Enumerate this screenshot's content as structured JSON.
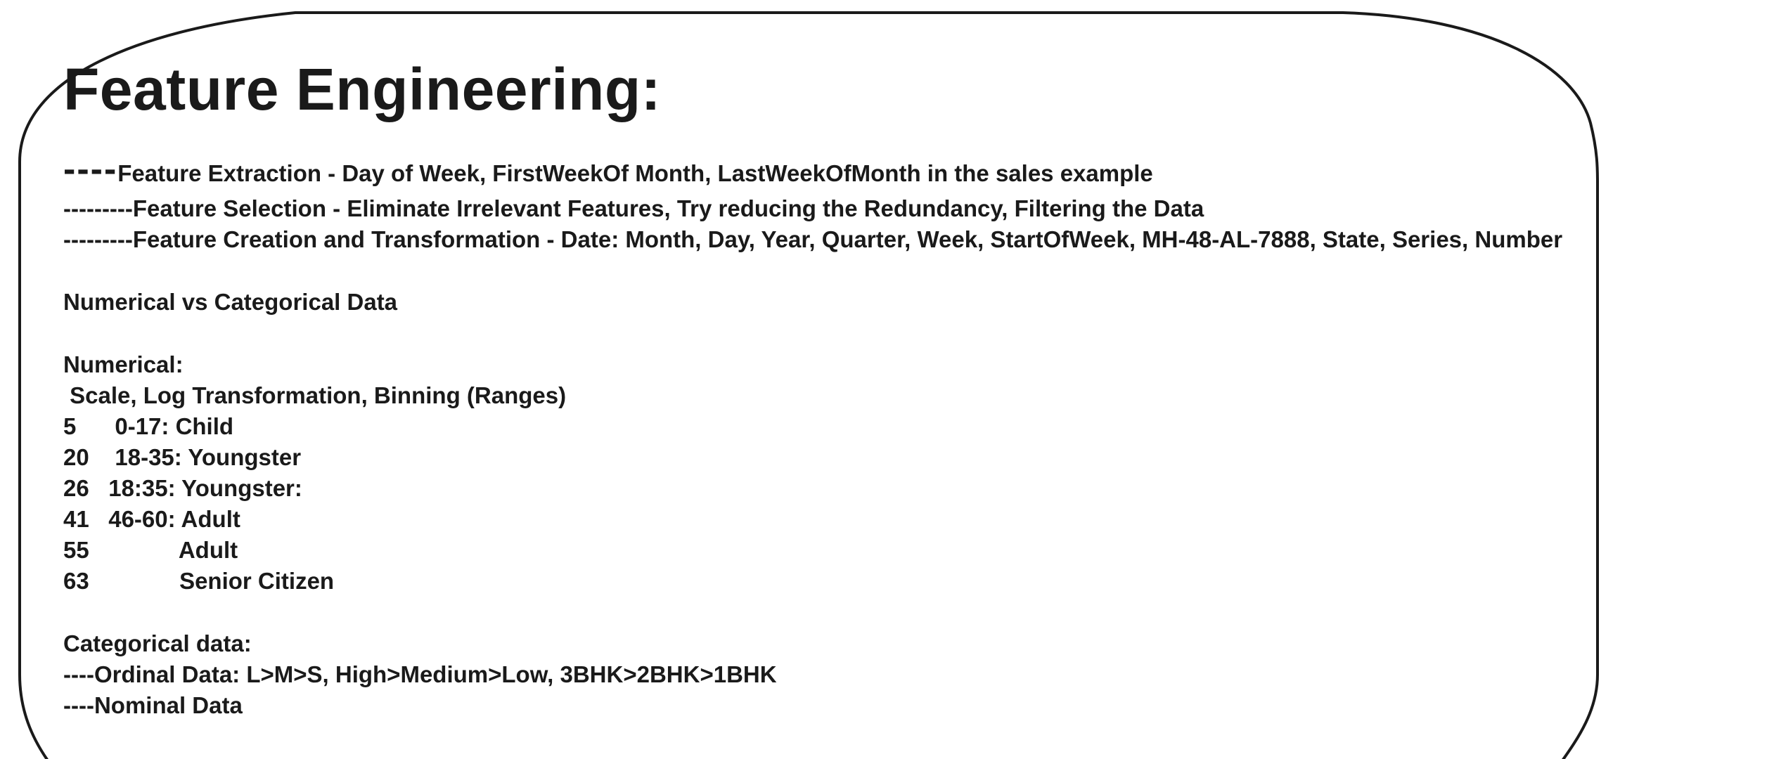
{
  "document": {
    "title": "Feature Engineering:",
    "feature_lines": [
      {
        "lead": "----",
        "text": "Feature Extraction - Day of Week, FirstWeekOf Month, LastWeekOfMonth in the sales example"
      },
      {
        "lead": "",
        "text": "---------Feature Selection - Eliminate Irrelevant Features, Try reducing the Redundancy, Filtering the Data"
      },
      {
        "lead": "",
        "text": "---------Feature Creation and Transformation - Date: Month, Day, Year, Quarter, Week, StartOfWeek, MH-48-AL-7888, State, Series, Number"
      }
    ],
    "comparison_heading": "Numerical vs Categorical Data",
    "numerical": {
      "heading": "Numerical:",
      "methods": " Scale, Log Transformation, Binning (Ranges)",
      "rows": [
        "5      0-17: Child",
        "20    18-35: Youngster",
        "26   18:35: Youngster:",
        "41   46-60: Adult",
        "55              Adult",
        "63              Senior Citizen"
      ]
    },
    "categorical": {
      "heading": "Categorical data:",
      "ordinal": "----Ordinal Data: L>M>S, High>Medium>Low, 3BHK>2BHK>1BHK",
      "nominal": "----Nominal Data"
    }
  },
  "colors": {
    "text": "#1a1a1a",
    "border": "#1a1a1a",
    "background": "#ffffff"
  }
}
